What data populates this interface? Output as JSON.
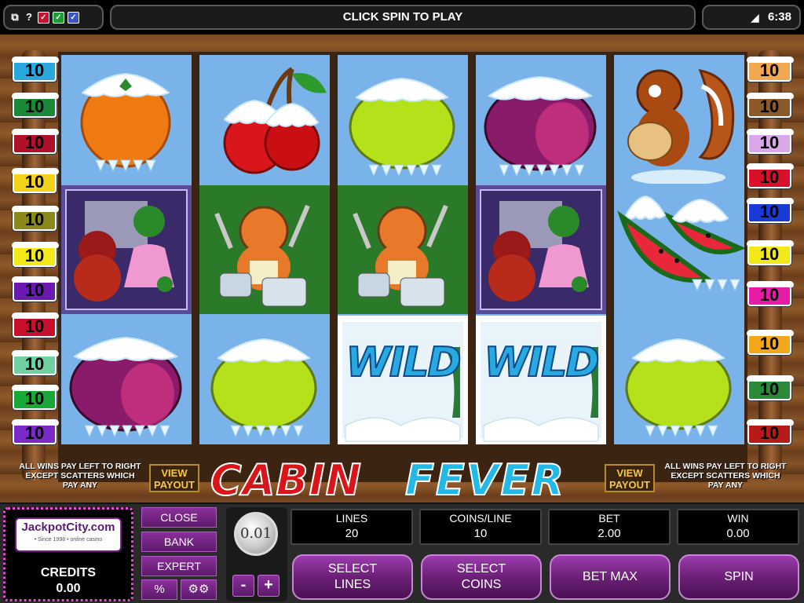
{
  "top_bar": {
    "message": "CLICK SPIN TO PLAY",
    "time": "6:38",
    "icons": [
      "window-icon",
      "help-icon",
      "flag-red-icon",
      "flag-green-icon",
      "flag-blue-icon",
      "wifi-icon"
    ]
  },
  "paylines": {
    "left": [
      {
        "label": "10",
        "color": "#29a8e0"
      },
      {
        "label": "10",
        "color": "#1a8a3a"
      },
      {
        "label": "10",
        "color": "#b0102a"
      },
      {
        "label": "10",
        "color": "#f2d21a"
      },
      {
        "label": "10",
        "color": "#8a8a1a"
      },
      {
        "label": "10",
        "color": "#f2e81a"
      },
      {
        "label": "10",
        "color": "#6a1ab0"
      },
      {
        "label": "10",
        "color": "#c8102e"
      },
      {
        "label": "10",
        "color": "#6fd0a0"
      },
      {
        "label": "10",
        "color": "#18a838"
      },
      {
        "label": "10",
        "color": "#7a2ac8"
      }
    ],
    "right": [
      {
        "label": "10",
        "color": "#f2a850"
      },
      {
        "label": "10",
        "color": "#8a5a2a"
      },
      {
        "label": "10",
        "color": "#d8a8e8"
      },
      {
        "label": "10",
        "color": "#d8102a"
      },
      {
        "label": "10",
        "color": "#1a3ad8"
      },
      {
        "label": "10",
        "color": "#f2e81a"
      },
      {
        "label": "10",
        "color": "#e81aa8"
      },
      {
        "label": "10",
        "color": "#f2a81a"
      },
      {
        "label": "10",
        "color": "#2a8a3a"
      },
      {
        "label": "10",
        "color": "#b81a1a"
      }
    ]
  },
  "reels": [
    [
      "orange",
      "bears",
      "plum"
    ],
    [
      "cherries",
      "beaver",
      "lemon"
    ],
    [
      "lemon",
      "beaver",
      "wild"
    ],
    [
      "plum",
      "bears",
      "wild"
    ],
    [
      "squirrel",
      "watermelon",
      "lemon"
    ]
  ],
  "wild_text": "WILD",
  "footer": {
    "rule_text_left": "ALL WINS PAY LEFT TO RIGHT EXCEPT SCATTERS WHICH PAY ANY",
    "rule_text_right": "ALL WINS PAY LEFT TO RIGHT EXCEPT SCATTERS WHICH PAY ANY",
    "view_payout_left": "VIEW PAYOUT",
    "view_payout_right": "VIEW PAYOUT",
    "title_word1": "CABIN",
    "title_word2": "FEVER"
  },
  "panel": {
    "casino_brand": "JackpotCity.com",
    "casino_sub": "• Since 1998 • online casino",
    "credits_label": "CREDITS",
    "credits_value": "0.00",
    "menu": {
      "close": "CLOSE",
      "bank": "BANK",
      "expert": "EXPERT",
      "percent": "%",
      "settings": "settings-icon"
    },
    "coin_value": "0.01",
    "minus": "-",
    "plus": "+",
    "lines_label": "LINES",
    "lines_value": "20",
    "coins_line_label": "COINS/LINE",
    "coins_line_value": "10",
    "bet_label": "BET",
    "bet_value": "2.00",
    "win_label": "WIN",
    "win_value": "0.00",
    "select_lines": "SELECT LINES",
    "select_coins": "SELECT COINS",
    "bet_max": "BET MAX",
    "spin": "SPIN"
  }
}
